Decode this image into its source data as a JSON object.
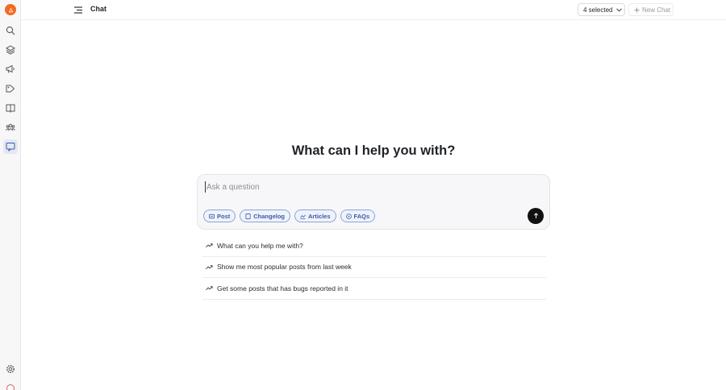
{
  "rail": {
    "items": [
      {
        "name": "search",
        "icon": "search-icon"
      },
      {
        "name": "layers",
        "icon": "layers-icon"
      },
      {
        "name": "announcements",
        "icon": "megaphone-icon"
      },
      {
        "name": "tags",
        "icon": "tag-icon"
      },
      {
        "name": "docs",
        "icon": "book-icon"
      },
      {
        "name": "users",
        "icon": "users-icon"
      },
      {
        "name": "chat",
        "icon": "chat-icon",
        "active": true
      }
    ],
    "settings_icon": "gear-icon",
    "avatar_icon": "avatar"
  },
  "header": {
    "title": "Chat",
    "selected_label": "4 selected",
    "new_chat_label": "New Chat"
  },
  "main": {
    "heading": "What can I help you with?",
    "input_placeholder": "Ask a question",
    "chips": [
      {
        "label": "Post",
        "icon": "post-icon"
      },
      {
        "label": "Changelog",
        "icon": "changelog-icon"
      },
      {
        "label": "Articles",
        "icon": "articles-icon"
      },
      {
        "label": "FAQs",
        "icon": "faq-icon"
      }
    ],
    "suggestions": [
      "What can you help me with?",
      "Show me most popular posts from last week",
      "Get some posts that has bugs reported in it"
    ]
  },
  "colors": {
    "brand": "#f26b21",
    "chip_border": "#8ea3d6",
    "chip_text": "#3c5aa6",
    "send_button": "#111111"
  }
}
